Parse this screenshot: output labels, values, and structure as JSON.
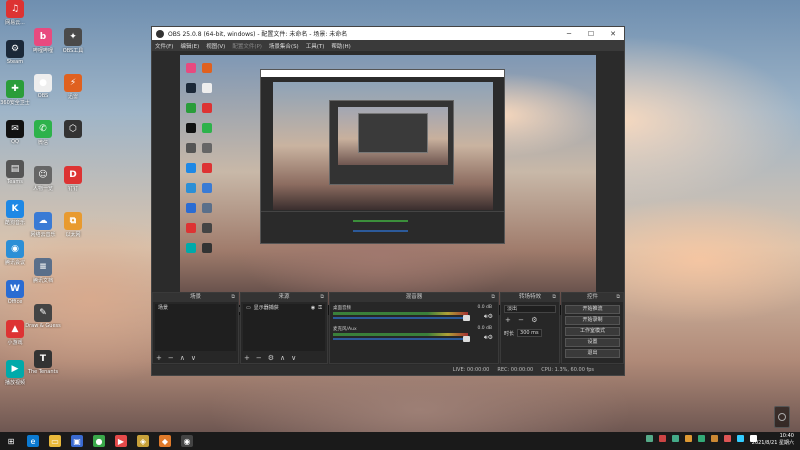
{
  "desktop": {
    "icons_col1": [
      {
        "label": "网易云...",
        "color": "#d33",
        "glyph": "♫"
      },
      {
        "label": "Steam",
        "color": "#1b2838",
        "glyph": "⚙"
      },
      {
        "label": "360安全卫士",
        "color": "#2a9d3a",
        "glyph": "✚"
      },
      {
        "label": "QQ",
        "color": "#111",
        "glyph": "✉"
      },
      {
        "label": "Teams",
        "color": "#555",
        "glyph": "▤"
      },
      {
        "label": "酷狗音乐",
        "color": "#1e88e5",
        "glyph": "K"
      },
      {
        "label": "腾讯会议",
        "color": "#2c8fd6",
        "glyph": "◉"
      },
      {
        "label": "Office",
        "color": "#2b6cd2",
        "glyph": "W"
      },
      {
        "label": "小游戏",
        "color": "#d33",
        "glyph": "▲"
      },
      {
        "label": "播放视频",
        "color": "#0aa",
        "glyph": "▶"
      }
    ],
    "icons_col2": [
      {
        "label": "哔哩哔哩",
        "color": "#e84a7f",
        "glyph": "b"
      },
      {
        "label": "OBS",
        "color": "#eee",
        "glyph": "●"
      },
      {
        "label": "微信",
        "color": "#2db24b",
        "glyph": "✆"
      },
      {
        "label": "人物一览",
        "color": "#666",
        "glyph": "☺"
      },
      {
        "label": "网络云音乐",
        "color": "#3a7bd5",
        "glyph": "☁"
      },
      {
        "label": "腾讯文档",
        "color": "#5a6f8a",
        "glyph": "≡"
      },
      {
        "label": "Draw & Guess",
        "color": "#444",
        "glyph": "✎"
      },
      {
        "label": "The Tenants",
        "color": "#333",
        "glyph": "T"
      }
    ],
    "icons_col3": [
      {
        "label": "OBS工具",
        "color": "#4a4a4a",
        "glyph": "✦"
      },
      {
        "label": "迅雷",
        "color": "#e0611f",
        "glyph": "⚡"
      },
      {
        "label": "",
        "color": "#333",
        "glyph": "⬡"
      },
      {
        "label": "钉钉",
        "color": "#d33",
        "glyph": "D"
      },
      {
        "label": "以太网",
        "color": "#e89a2f",
        "glyph": "⧉"
      }
    ]
  },
  "obs": {
    "title": "OBS 25.0.8 (64-bit, windows) - 配置文件: 未命名 - 场景: 未命名",
    "window_buttons": [
      "─",
      "☐",
      "✕"
    ],
    "menu": [
      "文件(F)",
      "编辑(E)",
      "视图(V)",
      "配置文件(P)",
      "场景集合(S)",
      "工具(T)",
      "帮助(H)"
    ],
    "docks": {
      "scenes": {
        "title": "场景",
        "items": [
          "场景"
        ],
        "footer": [
          "+",
          "−",
          "∧",
          "∨"
        ]
      },
      "sources": {
        "title": "来源",
        "items": [
          "显示器捕获"
        ],
        "footer": [
          "+",
          "−",
          "⚙",
          "∧",
          "∨"
        ]
      },
      "mixer": {
        "title": "混音器",
        "tracks": [
          {
            "name": "桌面音频",
            "level": "0.0 dB"
          },
          {
            "name": "麦克风/Aux",
            "level": "0.0 dB"
          }
        ]
      },
      "transitions": {
        "title": "转场特效",
        "type": "淡出",
        "duration_label": "时长",
        "duration": "300 ms",
        "footer": [
          "+",
          "−",
          "⚙"
        ]
      },
      "controls": {
        "title": "控件",
        "buttons": [
          "开始推流",
          "开始录制",
          "工作室模式",
          "设置",
          "退出"
        ]
      }
    },
    "status": {
      "live": "LIVE: 00:00:00",
      "rec": "REC: 00:00:00",
      "cpu": "CPU: 1.3%, 60.00 fps"
    }
  },
  "taskbar": {
    "icons": [
      {
        "name": "start-icon",
        "glyph": "⊞",
        "color": "#1a1a1a"
      },
      {
        "name": "edge-icon",
        "glyph": "e",
        "color": "#0b7ad1"
      },
      {
        "name": "file-explorer-icon",
        "glyph": "▭",
        "color": "#e8b83a"
      },
      {
        "name": "store-icon",
        "glyph": "▣",
        "color": "#3a6ad0"
      },
      {
        "name": "app-icon",
        "glyph": "●",
        "color": "#3aa84a"
      },
      {
        "name": "video-icon",
        "glyph": "▶",
        "color": "#e54a4a"
      },
      {
        "name": "game-icon",
        "glyph": "◈",
        "color": "#c8a13a"
      },
      {
        "name": "app2-icon",
        "glyph": "◆",
        "color": "#e07a2a"
      },
      {
        "name": "obs-icon",
        "glyph": "◉",
        "color": "#444"
      }
    ],
    "tray_colors": [
      "#5a8",
      "#c44",
      "#4a8",
      "#d93",
      "#3a7",
      "#c83",
      "#d55",
      "#3cf",
      "#fff"
    ],
    "time": "10:40",
    "date": "2021/8/21 星期六"
  },
  "colors": {
    "accent": "#3b8f3b",
    "obs_bg": "#2b2b2b",
    "panel": "#272727"
  }
}
